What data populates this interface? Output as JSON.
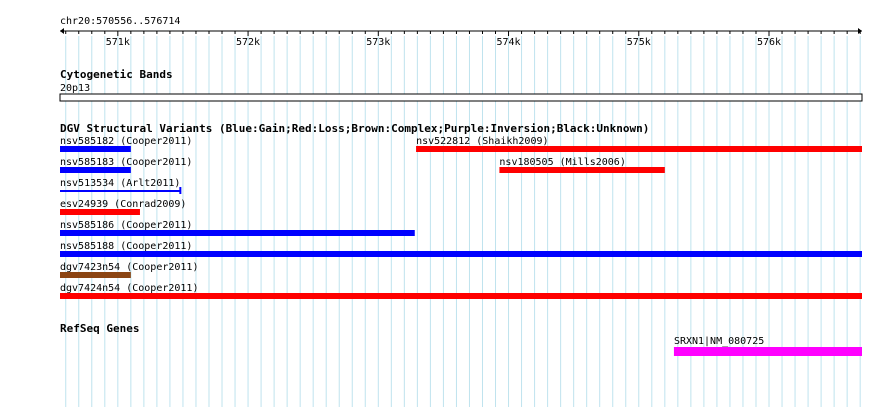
{
  "region": {
    "label": "chr20:570556..576714",
    "start": 570556,
    "end": 576714
  },
  "ruler": {
    "major_ticks": [
      {
        "pos": 571000,
        "label": "571k"
      },
      {
        "pos": 572000,
        "label": "572k"
      },
      {
        "pos": 573000,
        "label": "573k"
      },
      {
        "pos": 574000,
        "label": "574k"
      },
      {
        "pos": 575000,
        "label": "575k"
      },
      {
        "pos": 576000,
        "label": "576k"
      }
    ],
    "minor_step": 100
  },
  "cytoband": {
    "title": "Cytogenetic Bands",
    "band_label": "20p13"
  },
  "dgv": {
    "title": "DGV Structural Variants (Blue:Gain;Red:Loss;Brown:Complex;Purple:Inversion;Black:Unknown)",
    "colors": {
      "gain": "#0000ff",
      "loss": "#ff0000",
      "complex": "#8b4513",
      "inversion": "#800080",
      "unknown": "#000000"
    },
    "features": [
      {
        "name": "nsv585182 (Cooper2011)",
        "start": 570556,
        "end": 571100,
        "type": "gain",
        "row": 0,
        "style": "thick"
      },
      {
        "name": "nsv522812 (Shaikh2009)",
        "start": 573290,
        "end": 576714,
        "type": "loss",
        "row": 0,
        "style": "thick"
      },
      {
        "name": "nsv585183 (Cooper2011)",
        "start": 570556,
        "end": 571100,
        "type": "gain",
        "row": 1,
        "style": "thick"
      },
      {
        "name": "nsv180505 (Mills2006)",
        "start": 573930,
        "end": 575200,
        "type": "loss",
        "row": 1,
        "style": "thick"
      },
      {
        "name": "nsv513534 (Arlt2011)",
        "start": 570556,
        "end": 571480,
        "type": "gain",
        "row": 2,
        "style": "thin"
      },
      {
        "name": "esv24939 (Conrad2009)",
        "start": 570556,
        "end": 571170,
        "type": "loss",
        "row": 3,
        "style": "thick"
      },
      {
        "name": "nsv585186 (Cooper2011)",
        "start": 570556,
        "end": 573280,
        "type": "gain",
        "row": 4,
        "style": "thick"
      },
      {
        "name": "nsv585188 (Cooper2011)",
        "start": 570556,
        "end": 576714,
        "type": "gain",
        "row": 5,
        "style": "thick"
      },
      {
        "name": "dgv7423n54 (Cooper2011)",
        "start": 570556,
        "end": 571100,
        "type": "complex",
        "row": 6,
        "style": "thick"
      },
      {
        "name": "dgv7424n54 (Cooper2011)",
        "start": 570556,
        "end": 576714,
        "type": "loss",
        "row": 7,
        "style": "thick"
      }
    ]
  },
  "refseq": {
    "title": "RefSeq Genes",
    "color": "#ff00ff",
    "features": [
      {
        "name": "SRXN1|NM_080725",
        "start": 575270,
        "end": 576714
      }
    ]
  }
}
